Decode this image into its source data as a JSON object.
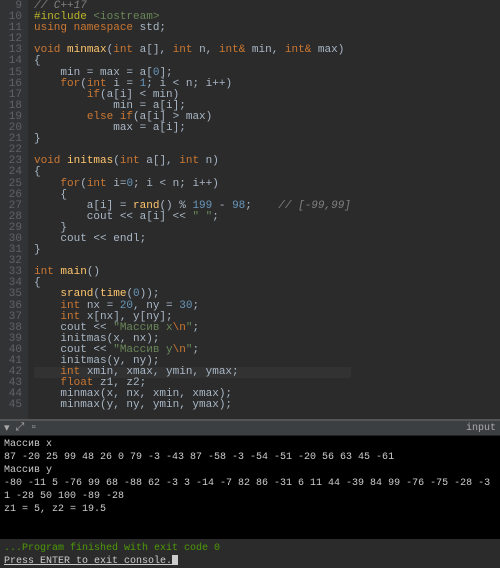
{
  "editor": {
    "first_line": 9,
    "lines": [
      [
        [
          "c-comment",
          "// C++17"
        ]
      ],
      [
        [
          "c-preproc",
          "#include "
        ],
        [
          "c-include",
          "<iostream>"
        ]
      ],
      [
        [
          "c-keyword",
          "using namespace "
        ],
        [
          "",
          "std;"
        ]
      ],
      [
        [
          "",
          ""
        ]
      ],
      [
        [
          "c-type",
          "void "
        ],
        [
          "c-func",
          "minmax"
        ],
        [
          "",
          "("
        ],
        [
          "c-type",
          "int "
        ],
        [
          "",
          "a[], "
        ],
        [
          "c-type",
          "int "
        ],
        [
          "",
          "n, "
        ],
        [
          "c-type",
          "int"
        ],
        [
          "c-special",
          "& "
        ],
        [
          "",
          "min, "
        ],
        [
          "c-type",
          "int"
        ],
        [
          "c-special",
          "& "
        ],
        [
          "",
          "max)"
        ]
      ],
      [
        [
          "",
          "{"
        ]
      ],
      [
        [
          "",
          "    min = max = a["
        ],
        [
          "c-num",
          "0"
        ],
        [
          "",
          "];"
        ]
      ],
      [
        [
          "",
          "    "
        ],
        [
          "c-keyword",
          "for"
        ],
        [
          "",
          "("
        ],
        [
          "c-type",
          "int "
        ],
        [
          "",
          "i = "
        ],
        [
          "c-num",
          "1"
        ],
        [
          "",
          "; i < n; i++)"
        ]
      ],
      [
        [
          "",
          "        "
        ],
        [
          "c-keyword",
          "if"
        ],
        [
          "",
          "(a[i] < min)"
        ]
      ],
      [
        [
          "",
          "            min = a[i];"
        ]
      ],
      [
        [
          "",
          "        "
        ],
        [
          "c-keyword",
          "else if"
        ],
        [
          "",
          "(a[i] > max)"
        ]
      ],
      [
        [
          "",
          "            max = a[i];"
        ]
      ],
      [
        [
          "",
          "}"
        ]
      ],
      [
        [
          "",
          ""
        ]
      ],
      [
        [
          "c-type",
          "void "
        ],
        [
          "c-func",
          "initmas"
        ],
        [
          "",
          "("
        ],
        [
          "c-type",
          "int "
        ],
        [
          "",
          "a[], "
        ],
        [
          "c-type",
          "int "
        ],
        [
          "",
          "n)"
        ]
      ],
      [
        [
          "",
          "{"
        ]
      ],
      [
        [
          "",
          "    "
        ],
        [
          "c-keyword",
          "for"
        ],
        [
          "",
          "("
        ],
        [
          "c-type",
          "int "
        ],
        [
          "",
          "i="
        ],
        [
          "c-num",
          "0"
        ],
        [
          "",
          "; i < n; i++)"
        ]
      ],
      [
        [
          "",
          "    {"
        ]
      ],
      [
        [
          "",
          "        a[i] = "
        ],
        [
          "c-func",
          "rand"
        ],
        [
          "",
          "() % "
        ],
        [
          "c-num",
          "199"
        ],
        [
          "",
          ""
        ],
        [
          "",
          " - "
        ],
        [
          "c-num",
          "98"
        ],
        [
          "",
          ";    "
        ],
        [
          "c-comment",
          "// [-99,99]"
        ]
      ],
      [
        [
          "",
          "        cout << a[i] << "
        ],
        [
          "c-string",
          "\" \""
        ],
        [
          "",
          ";"
        ]
      ],
      [
        [
          "",
          "    }"
        ]
      ],
      [
        [
          "",
          "    cout << endl;"
        ]
      ],
      [
        [
          "",
          "}"
        ]
      ],
      [
        [
          "",
          ""
        ]
      ],
      [
        [
          "c-type",
          "int "
        ],
        [
          "c-func",
          "main"
        ],
        [
          "",
          "()"
        ]
      ],
      [
        [
          "",
          "{"
        ]
      ],
      [
        [
          "",
          "    "
        ],
        [
          "c-func",
          "srand"
        ],
        [
          "",
          "("
        ],
        [
          "c-func",
          "time"
        ],
        [
          "",
          "("
        ],
        [
          "c-num",
          "0"
        ],
        [
          "",
          "));"
        ]
      ],
      [
        [
          "",
          "    "
        ],
        [
          "c-type",
          "int "
        ],
        [
          "",
          "nx = "
        ],
        [
          "c-num",
          "20"
        ],
        [
          "",
          ", ny = "
        ],
        [
          "c-num",
          "30"
        ],
        [
          "",
          ";"
        ]
      ],
      [
        [
          "",
          "    "
        ],
        [
          "c-type",
          "int "
        ],
        [
          "",
          "x[nx], y[ny];"
        ]
      ],
      [
        [
          "",
          "    cout << "
        ],
        [
          "c-string",
          "\"Массив x"
        ],
        [
          "c-special",
          "\\n"
        ],
        [
          "c-string",
          "\""
        ],
        [
          "",
          ";"
        ]
      ],
      [
        [
          "",
          "    initmas(x, nx);"
        ]
      ],
      [
        [
          "",
          "    cout << "
        ],
        [
          "c-string",
          "\"Массив y"
        ],
        [
          "c-special",
          "\\n"
        ],
        [
          "c-string",
          "\""
        ],
        [
          "",
          ";"
        ]
      ],
      [
        [
          "",
          "    initmas(y, ny);"
        ]
      ],
      [
        [
          "",
          "    "
        ],
        [
          "c-type",
          "int "
        ],
        [
          "",
          "xmin, xmax, ymin, ymax;"
        ]
      ],
      [
        [
          "",
          "    "
        ],
        [
          "c-type",
          "float "
        ],
        [
          "",
          "z1, z2;"
        ]
      ],
      [
        [
          "",
          "    minmax(x, nx, xmin, xmax);"
        ]
      ],
      [
        [
          "",
          "    minmax(y, ny, ymin, ymax);"
        ]
      ]
    ],
    "highlighted_line_index": 33
  },
  "divider": {
    "label": "input"
  },
  "terminal": {
    "lines": [
      "Массив x",
      "87 -20 25 99 48 26 0 79 -3 -43 87 -58 -3 -54 -51 -20 56 63 45 -61",
      "Массив y",
      "-80 -11 5 -76 99 68 -88 62 -3 3 -14 -7 82 86 -31 6 11 44 -39 84 99 -76 -75 -28 -31 -28 50 100 -89 -28",
      "z1 = 5, z2 = 19.5",
      "",
      "",
      "...Program finished with exit code 0"
    ],
    "prompt": "Press ENTER to exit console."
  }
}
